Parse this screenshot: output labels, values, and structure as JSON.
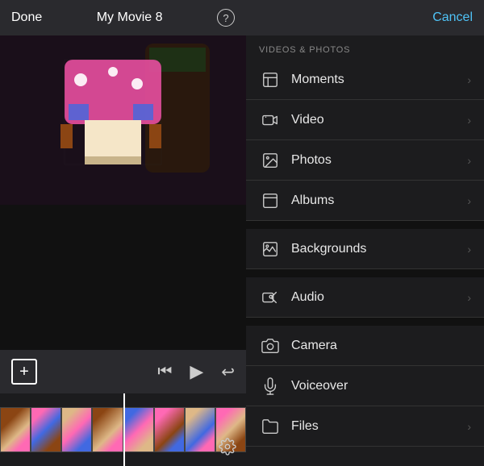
{
  "left": {
    "done_label": "Done",
    "title": "My Movie 8",
    "help_label": "?",
    "add_label": "+",
    "settings_label": "⚙",
    "frame_count": 8
  },
  "right": {
    "cancel_label": "Cancel",
    "section_label": "VIDEOS & PHOTOS",
    "menu_items": [
      {
        "id": "moments",
        "label": "Moments",
        "icon": "moments"
      },
      {
        "id": "video",
        "label": "Video",
        "icon": "video"
      },
      {
        "id": "photos",
        "label": "Photos",
        "icon": "photos"
      },
      {
        "id": "albums",
        "label": "Albums",
        "icon": "albums"
      }
    ],
    "menu_items2": [
      {
        "id": "backgrounds",
        "label": "Backgrounds",
        "icon": "backgrounds"
      },
      {
        "id": "audio",
        "label": "Audio",
        "icon": "audio"
      },
      {
        "id": "camera",
        "label": "Camera",
        "icon": "camera"
      },
      {
        "id": "voiceover",
        "label": "Voiceover",
        "icon": "voiceover"
      },
      {
        "id": "files",
        "label": "Files",
        "icon": "files"
      }
    ]
  }
}
